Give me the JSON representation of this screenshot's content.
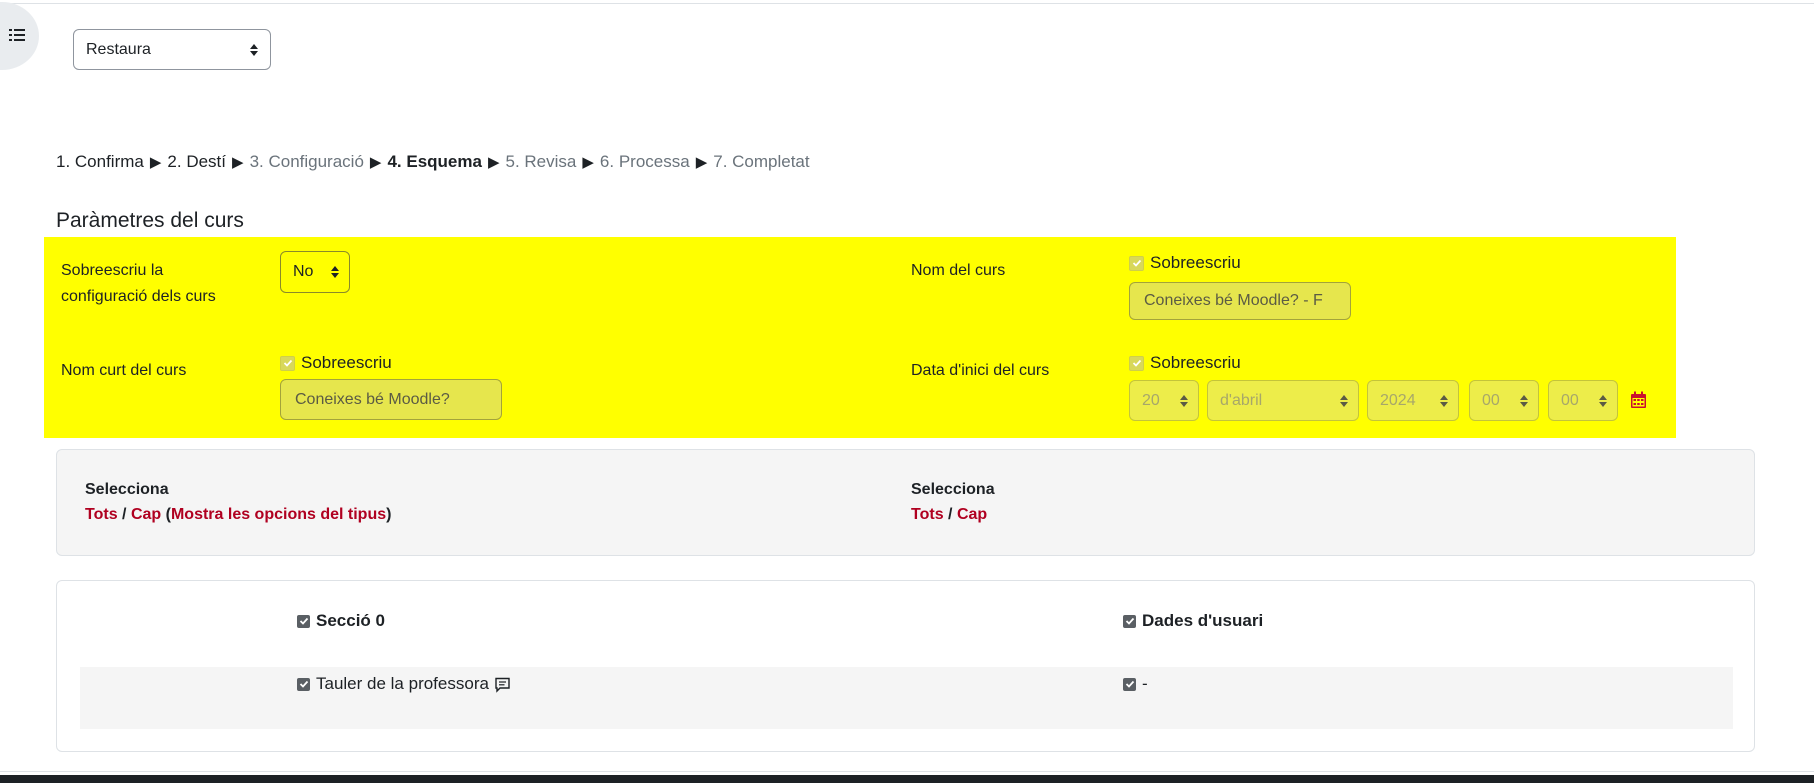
{
  "restore_select": {
    "value": "Restaura"
  },
  "steps": [
    {
      "label": "1. Confirma",
      "state": "done"
    },
    {
      "label": "2. Destí",
      "state": "done"
    },
    {
      "label": "3. Configuració",
      "state": "todo"
    },
    {
      "label": "4. Esquema",
      "state": "current"
    },
    {
      "label": "5. Revisa",
      "state": "todo"
    },
    {
      "label": "6. Processa",
      "state": "todo"
    },
    {
      "label": "7. Completat",
      "state": "todo"
    }
  ],
  "step_separator": "▶",
  "settings": {
    "title": "Paràmetres del curs",
    "overwrite_conf_label_1": "Sobreescriu la",
    "overwrite_conf_label_2": "configuració dels curs",
    "overwrite_conf_value": "No",
    "course_name_label": "Nom del curs",
    "course_name_overwrite": "Sobreescriu",
    "course_name_value": "Coneixes bé Moodle? - F",
    "short_name_label": "Nom curt del curs",
    "short_name_overwrite": "Sobreescriu",
    "short_name_value": "Coneixes bé Moodle?",
    "start_date_label": "Data d'inici del curs",
    "start_date_overwrite": "Sobreescriu",
    "start_day": "20",
    "start_month": "d'abril",
    "start_year": "2024",
    "start_hour": "00",
    "start_minute": "00"
  },
  "select_left": {
    "heading": "Selecciona",
    "all": "Tots",
    "slash": "/",
    "none": "Cap",
    "open_paren": "(",
    "show_types": "Mostra les opcions del tipus",
    "close_paren": ")"
  },
  "select_right": {
    "heading": "Selecciona",
    "all": "Tots",
    "slash": "/",
    "none": "Cap"
  },
  "schema": {
    "section_label": "Secció 0",
    "user_data_label": "Dades d'usuari",
    "item_label": "Tauler de la professora",
    "item_user_data": "-"
  },
  "colors": {
    "highlight": "#ffff00",
    "link": "#b00020"
  },
  "icons": {
    "drawer": "list-icon",
    "calendar": "calendar-icon",
    "comment": "comment-icon"
  }
}
